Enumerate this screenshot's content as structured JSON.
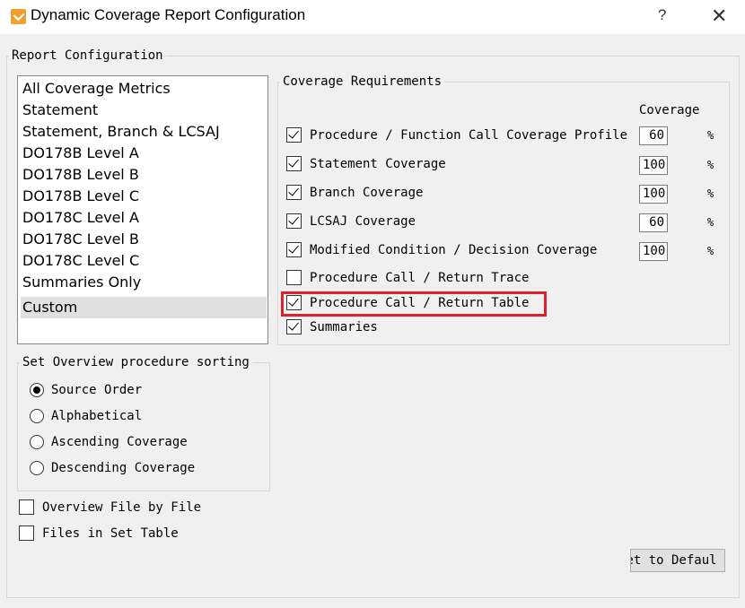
{
  "window": {
    "title": "Dynamic Coverage Report Configuration",
    "help_label": "?",
    "close_label": "✕"
  },
  "report_config": {
    "legend": "Report Configuration",
    "list_items": [
      "All Coverage Metrics",
      "Statement",
      "Statement, Branch & LCSAJ",
      "DO178B Level A",
      "DO178B Level B",
      "DO178B Level C",
      "DO178C Level A",
      "DO178C Level B",
      "DO178C Level C",
      "Summaries Only",
      "Custom"
    ],
    "selected_index": 10
  },
  "sorting": {
    "legend": "Set Overview procedure sorting",
    "options": [
      {
        "label": "Source Order",
        "checked": true
      },
      {
        "label": "Alphabetical",
        "checked": false
      },
      {
        "label": "Ascending Coverage",
        "checked": false
      },
      {
        "label": "Descending Coverage",
        "checked": false
      }
    ]
  },
  "bottom_checks": [
    {
      "label": "Overview File by File",
      "checked": false
    },
    {
      "label": "Files in Set Table",
      "checked": false
    }
  ],
  "coverage_requirements": {
    "legend": "Coverage Requirements",
    "column_header": "Coverage",
    "percent_symbol": "%",
    "items": [
      {
        "label": "Procedure / Function Call Coverage Profile",
        "checked": true,
        "value": "60"
      },
      {
        "label": "Statement Coverage",
        "checked": true,
        "value": "100"
      },
      {
        "label": "Branch Coverage",
        "checked": true,
        "value": "100"
      },
      {
        "label": "LCSAJ Coverage",
        "checked": true,
        "value": "60"
      },
      {
        "label": "Modified Condition / Decision Coverage",
        "checked": true,
        "value": "100"
      },
      {
        "label": "Procedure Call / Return Trace",
        "checked": false
      },
      {
        "label": "Procedure Call / Return Table",
        "checked": true,
        "highlighted": true
      },
      {
        "label": "Summaries",
        "checked": true
      }
    ]
  },
  "reset_button_label": "set to Defaul",
  "colors": {
    "highlight": "#e0202a",
    "list_selected": "#e0e0e0"
  }
}
